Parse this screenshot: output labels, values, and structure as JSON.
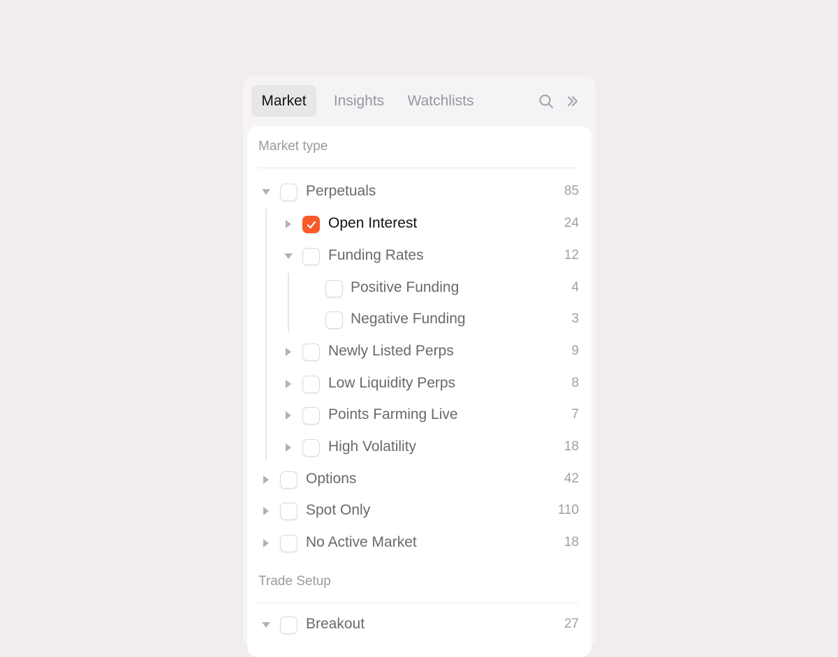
{
  "tabs": {
    "market": "Market",
    "insights": "Insights",
    "watchlists": "Watchlists"
  },
  "icons": {
    "search": "search-icon",
    "collapse": "chevrons-right-icon",
    "check": "check-icon"
  },
  "colors": {
    "accent": "#fa5a28",
    "background": "#f0ecef"
  },
  "sections": {
    "market_type": "Market type",
    "trade_setup": "Trade Setup"
  },
  "market_type": {
    "perpetuals": {
      "label": "Perpetuals",
      "count": "85",
      "expanded": true,
      "checked": false
    },
    "open_interest": {
      "label": "Open Interest",
      "count": "24",
      "expanded": false,
      "checked": true
    },
    "funding_rates": {
      "label": "Funding Rates",
      "count": "12",
      "expanded": true,
      "checked": false
    },
    "positive_funding": {
      "label": "Positive Funding",
      "count": "4",
      "checked": false
    },
    "negative_funding": {
      "label": "Negative Funding",
      "count": "3",
      "checked": false
    },
    "newly_listed": {
      "label": "Newly Listed Perps",
      "count": "9",
      "expanded": false,
      "checked": false
    },
    "low_liquidity": {
      "label": "Low Liquidity Perps",
      "count": "8",
      "expanded": false,
      "checked": false
    },
    "points_farming": {
      "label": "Points Farming Live",
      "count": "7",
      "expanded": false,
      "checked": false
    },
    "high_volatility": {
      "label": "High Volatility",
      "count": "18",
      "expanded": false,
      "checked": false
    },
    "options": {
      "label": "Options",
      "count": "42",
      "expanded": false,
      "checked": false
    },
    "spot_only": {
      "label": "Spot Only",
      "count": "110",
      "expanded": false,
      "checked": false
    },
    "no_active_market": {
      "label": "No Active Market",
      "count": "18",
      "expanded": false,
      "checked": false
    }
  },
  "trade_setup": {
    "breakout": {
      "label": "Breakout",
      "count": "27",
      "expanded": true,
      "checked": false
    }
  }
}
